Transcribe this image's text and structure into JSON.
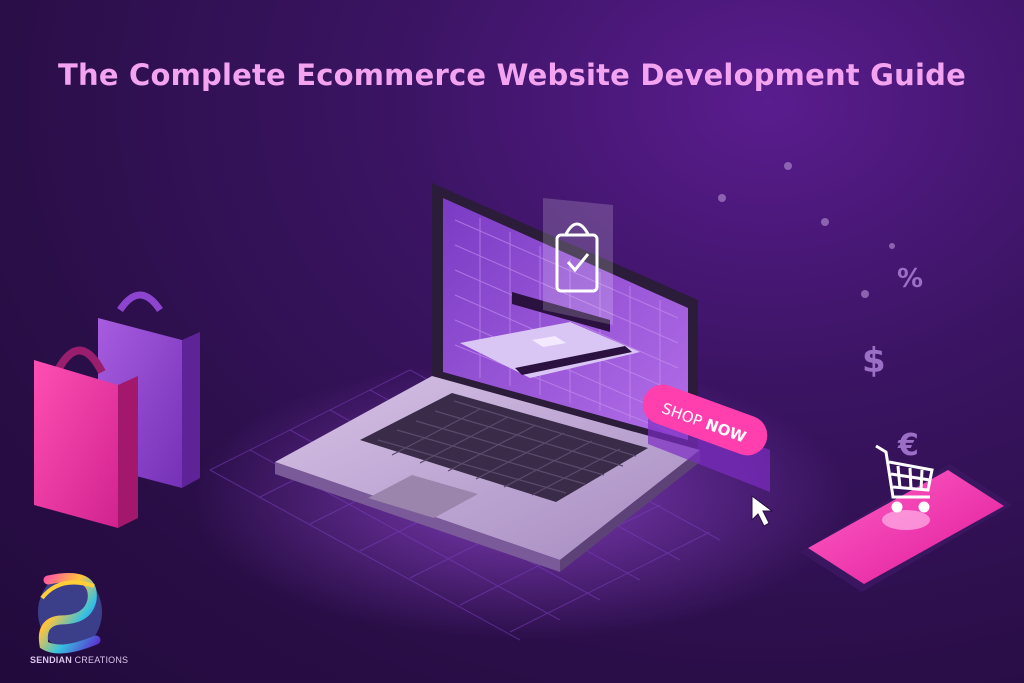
{
  "title": "The Complete Ecommerce Website Development Guide",
  "cta_label_start": "SHOP ",
  "cta_label_bold": "NOW",
  "symbols": {
    "percent": "%",
    "dollar": "$",
    "euro": "€"
  },
  "brand": {
    "name_bold": "SENDIAN",
    "name_rest": " CREATIONS"
  },
  "colors": {
    "background": "#2a0e48",
    "title": "#f3a3ef",
    "accent_pink": "#ff3fae",
    "accent_purple": "#9b3de0"
  },
  "icons": [
    "shopping-bag-icon",
    "credit-card-icon",
    "shopping-cart-icon",
    "cursor-icon",
    "brand-logo-icon"
  ]
}
